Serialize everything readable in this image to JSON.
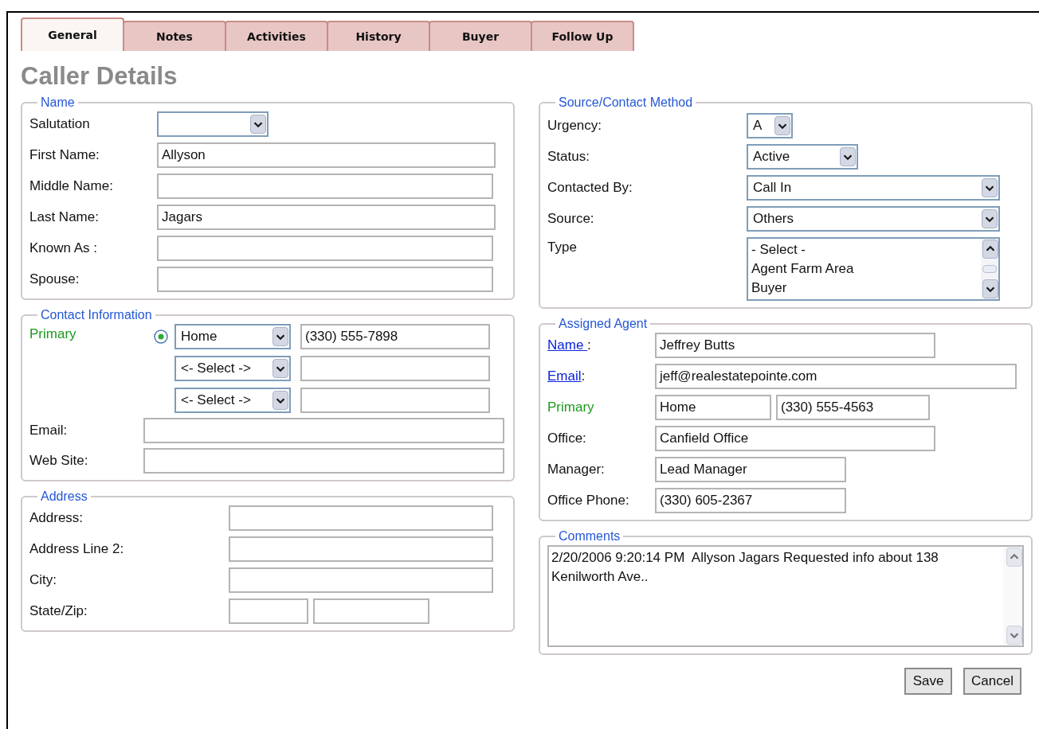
{
  "tabs": [
    {
      "label": "General",
      "selected": true
    },
    {
      "label": "Notes",
      "selected": false
    },
    {
      "label": "Activities",
      "selected": false
    },
    {
      "label": "History",
      "selected": false
    },
    {
      "label": "Buyer",
      "selected": false
    },
    {
      "label": "Follow Up",
      "selected": false
    }
  ],
  "title": "Caller Details",
  "name": {
    "legend": "Name",
    "fields": [
      {
        "label": "Salutation",
        "kind": "select"
      },
      {
        "label": "First Name:",
        "kind": "text",
        "value": "Allyson"
      },
      {
        "label": "Middle Name:",
        "kind": "text"
      },
      {
        "label": "Last Name:",
        "kind": "text",
        "value": "Jagars"
      },
      {
        "label": "Known As :",
        "kind": "text"
      },
      {
        "label": "Spouse:",
        "kind": "text"
      }
    ]
  },
  "contact": {
    "legend": "Contact Information",
    "primary_label": "Primary",
    "phones": [
      {
        "type": "Home",
        "number": "(330) 555-7898",
        "selected": true
      },
      {
        "type": "<- Select ->",
        "selected": false
      },
      {
        "type": "<- Select ->",
        "selected": false
      }
    ],
    "fields": [
      {
        "label": "Email:"
      },
      {
        "label": "Web Site:"
      }
    ]
  },
  "address": {
    "legend": "Address",
    "fields": [
      {
        "label": "Address:",
        "kind": "text"
      },
      {
        "label": "Address Line 2:",
        "kind": "text"
      },
      {
        "label": "City:",
        "kind": "text"
      },
      {
        "label": "State/Zip:",
        "kind": "split"
      }
    ]
  },
  "source": {
    "legend": "Source/Contact Method",
    "fields": [
      {
        "label": "Urgency:",
        "kind": "select",
        "value": "A"
      },
      {
        "label": "Status:",
        "kind": "select",
        "value": "Active"
      },
      {
        "label": "Contacted By:",
        "kind": "select",
        "value": "Call In"
      },
      {
        "label": "Source:",
        "kind": "select",
        "value": "Others"
      },
      {
        "label": "Type",
        "kind": "listbox",
        "options": [
          "- Select -",
          "Agent Farm Area",
          "Buyer"
        ]
      }
    ]
  },
  "agent": {
    "legend": "Assigned Agent",
    "fields": [
      {
        "kind": "link",
        "label": "Name ",
        "suffix": ":",
        "value": "Jeffrey Butts"
      },
      {
        "kind": "link",
        "label": "Email",
        "suffix": ":",
        "value": "jeff@realestatepointe.com"
      },
      {
        "kind": "pair",
        "label": "Primary",
        "values": [
          "Home",
          "(330) 555-4563"
        ]
      },
      {
        "kind": "text",
        "label": "Office:",
        "value": "Canfield Office"
      },
      {
        "kind": "text",
        "label": "Manager:",
        "value": "Lead Manager"
      },
      {
        "kind": "text",
        "label": "Office Phone:",
        "value": "(330) 605-2367"
      }
    ]
  },
  "comments": {
    "legend": "Comments",
    "text": "2/20/2006 9:20:14 PM  Allyson Jagars Requested info about 138 Kenilworth Ave.."
  },
  "buttons": [
    "Save",
    "Cancel"
  ]
}
